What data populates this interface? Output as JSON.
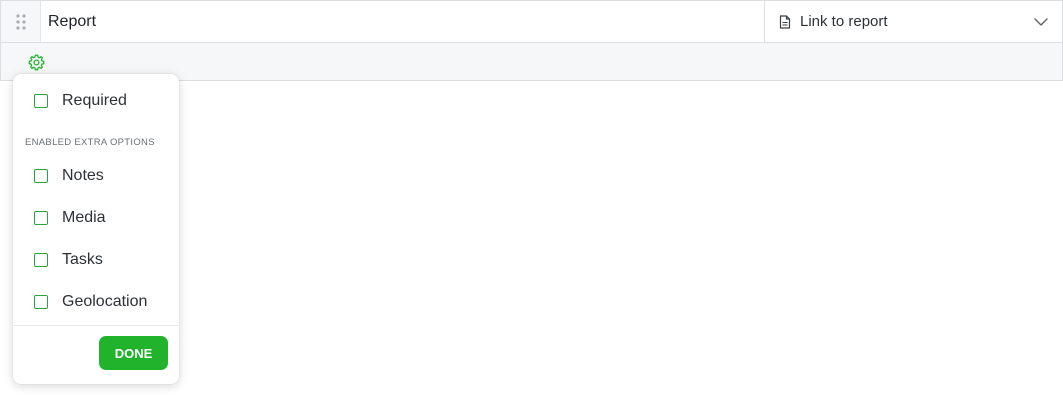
{
  "question": {
    "title_value": "Report",
    "response_type_label": "Link to report",
    "type_icon": "document-icon",
    "dropdown_icon": "chevron-down-icon"
  },
  "settings": {
    "gear_icon": "gear-icon",
    "popover": {
      "required_label": "Required",
      "section_heading": "ENABLED EXTRA OPTIONS",
      "options": [
        {
          "label": "Notes"
        },
        {
          "label": "Media"
        },
        {
          "label": "Tasks"
        },
        {
          "label": "Geolocation"
        }
      ],
      "done_label": "DONE"
    }
  },
  "colors": {
    "accent_green": "#21b32c",
    "checkbox_border": "#2aa33a",
    "bar_background": "#f6f7f8"
  }
}
